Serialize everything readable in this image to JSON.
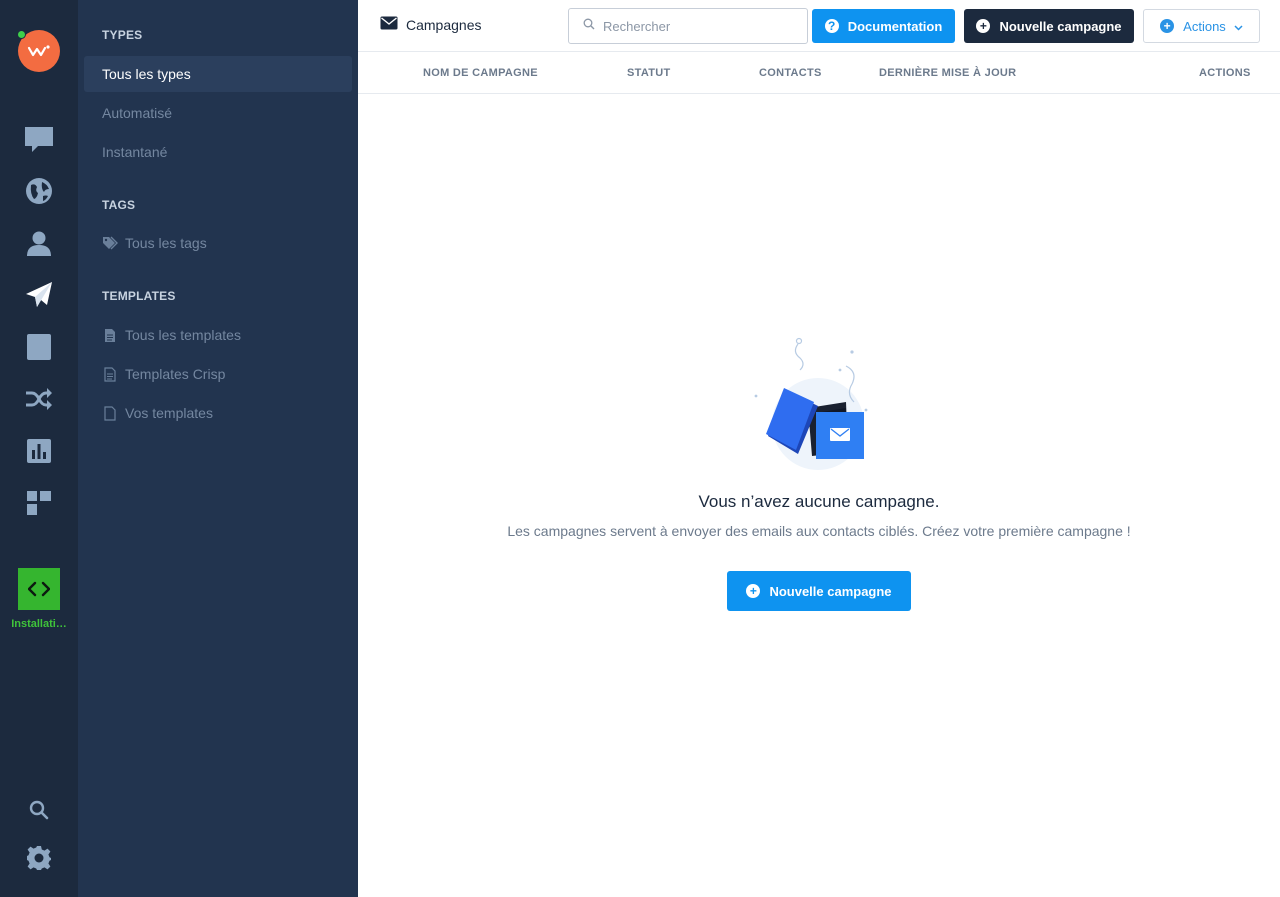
{
  "rail": {
    "install_label": "Installati…",
    "items": [
      "chatbox-icon",
      "globe-icon",
      "user-icon",
      "paper-plane-icon",
      "book-icon",
      "shuffle-icon",
      "chart-icon",
      "plugins-icon",
      "search-icon",
      "gear-icon"
    ]
  },
  "subnav": {
    "types_title": "TYPES",
    "types": [
      "Tous les types",
      "Automatisé",
      "Instantané"
    ],
    "tags_title": "TAGS",
    "tags": [
      "Tous les tags"
    ],
    "templates_title": "TEMPLATES",
    "templates": [
      "Tous les templates",
      "Templates Crisp",
      "Vos templates"
    ]
  },
  "header": {
    "title": "Campagnes",
    "search_placeholder": "Rechercher",
    "doc_label": "Documentation",
    "new_label": "Nouvelle campagne",
    "actions_label": "Actions"
  },
  "table": {
    "columns": [
      "NOM DE CAMPAGNE",
      "STATUT",
      "CONTACTS",
      "DERNIÈRE MISE À JOUR",
      "ACTIONS"
    ]
  },
  "empty": {
    "title": "Vous n’avez aucune campagne.",
    "subtitle": "Les campagnes servent à envoyer des emails aux contacts ciblés. Créez votre première campagne !",
    "cta_label": "Nouvelle campagne"
  },
  "colors": {
    "rail_bg": "#1c2a3e",
    "subnav_bg": "#22344f",
    "primary": "#0e93f0",
    "dark": "#1c2a3e",
    "install_green": "#35b52f"
  }
}
